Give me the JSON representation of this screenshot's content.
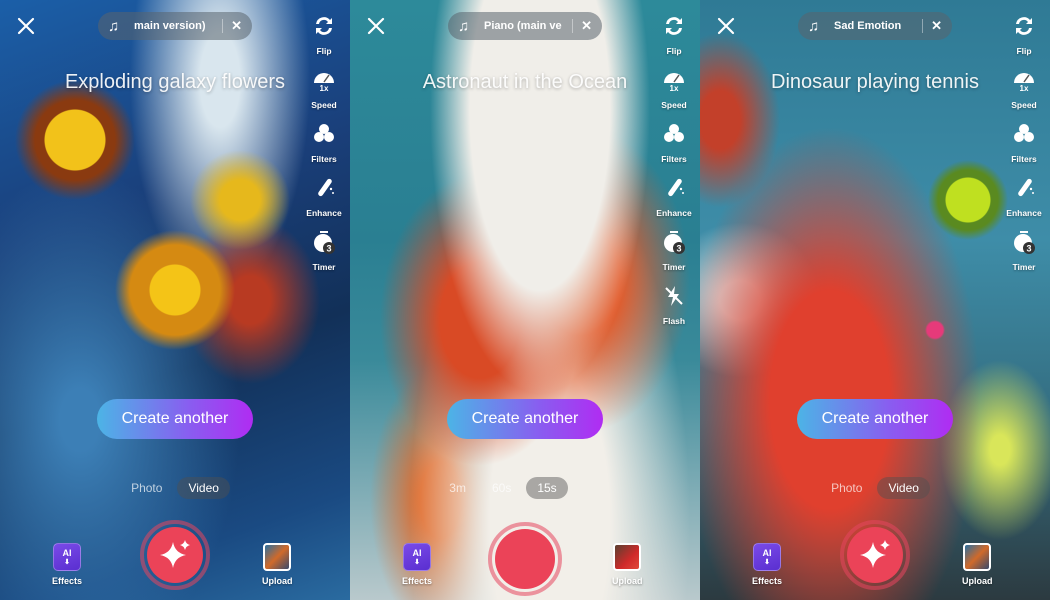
{
  "screens": [
    {
      "music_track": "main version)",
      "prompt": "Exploding galaxy flowers",
      "tools": [
        "Flip",
        "Speed",
        "Filters",
        "Enhance",
        "Timer"
      ],
      "create_label": "Create another",
      "modes": [
        {
          "label": "Photo",
          "active": false
        },
        {
          "label": "Video",
          "active": true
        }
      ],
      "effects_label": "Effects",
      "upload_label": "Upload",
      "ai_badge": "AI",
      "speed_value": "1x",
      "timer_value": "3"
    },
    {
      "music_track": "Piano (main ve",
      "prompt": "Astronaut in the Ocean",
      "tools": [
        "Flip",
        "Speed",
        "Filters",
        "Enhance",
        "Timer",
        "Flash"
      ],
      "create_label": "Create another",
      "modes": [
        {
          "label": "3m",
          "active": false
        },
        {
          "label": "60s",
          "active": false
        },
        {
          "label": "15s",
          "active": true
        }
      ],
      "effects_label": "Effects",
      "upload_label": "Upload",
      "ai_badge": "AI",
      "speed_value": "1x",
      "timer_value": "3"
    },
    {
      "music_track": "Sad Emotion",
      "prompt": "Dinosaur playing tennis",
      "tools": [
        "Flip",
        "Speed",
        "Filters",
        "Enhance",
        "Timer"
      ],
      "create_label": "Create another",
      "modes": [
        {
          "label": "Photo",
          "active": false
        },
        {
          "label": "Video",
          "active": true
        }
      ],
      "effects_label": "Effects",
      "upload_label": "Upload",
      "ai_badge": "AI",
      "speed_value": "1x",
      "timer_value": "3"
    }
  ],
  "icons": {
    "close": "close-icon",
    "music": "music-note-icon",
    "flip": "flip-camera-icon",
    "speed": "speed-gauge-icon",
    "filters": "filters-icon",
    "enhance": "enhance-wand-icon",
    "timer": "timer-icon",
    "flash": "flash-off-icon",
    "sparkle": "sparkle-icon"
  },
  "colors": {
    "shutter": "#eb4358",
    "create_gradient_start": "#4cb4e6",
    "create_gradient_end": "#b02cf2"
  }
}
